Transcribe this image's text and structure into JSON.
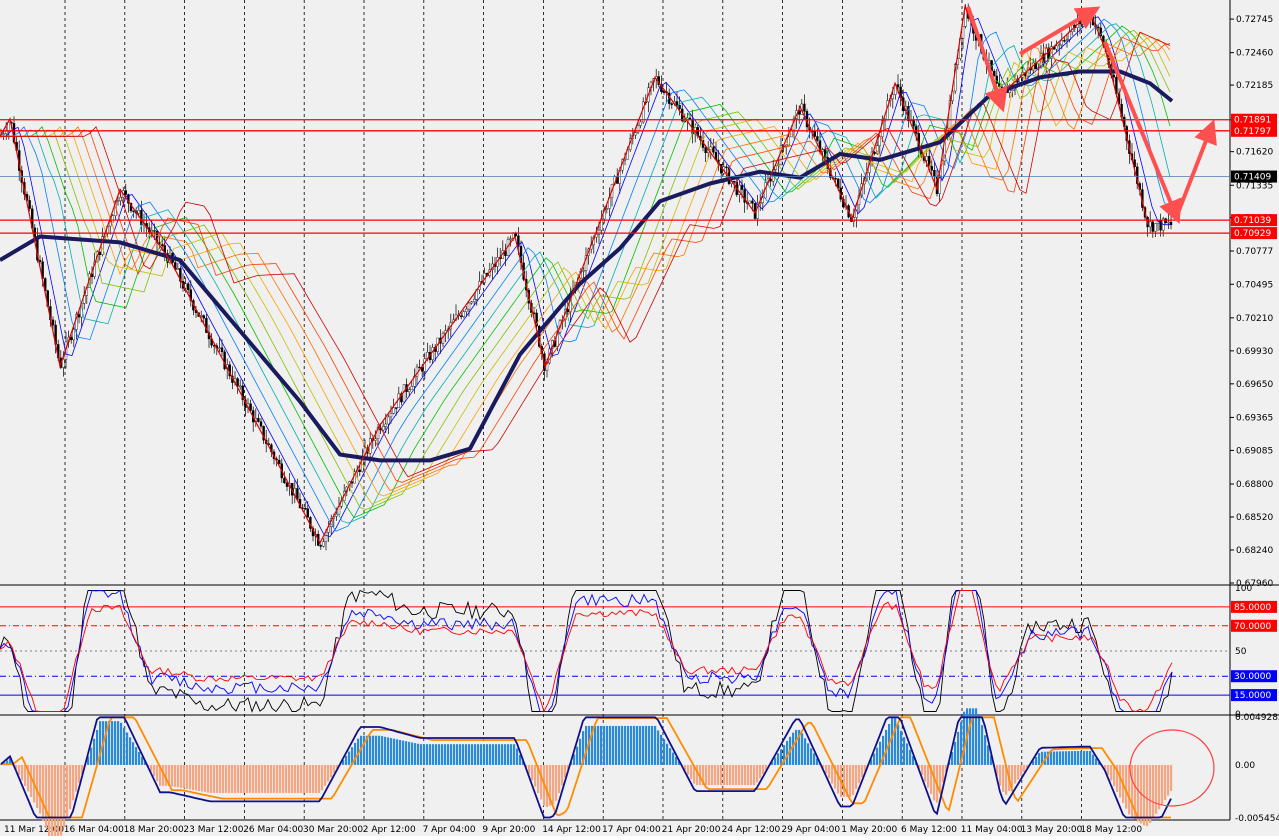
{
  "chart_data": [
    {
      "type": "candlestick",
      "panel": "price",
      "y_axis_ticks": [
        "0.72745",
        "0.72460",
        "0.72185",
        "0.71890",
        "0.71620",
        "0.71335",
        "0.71060",
        "0.70777",
        "0.70495",
        "0.70210",
        "0.69930",
        "0.69650",
        "0.69365",
        "0.69085",
        "0.68800",
        "0.68520",
        "0.68240",
        "0.67960"
      ],
      "ylim": [
        0.6796,
        0.7289
      ],
      "current_price": "0.71409",
      "levels": [
        {
          "label": "0.71891",
          "value": 0.71891,
          "color": "#ff0000"
        },
        {
          "label": "0.71797",
          "value": 0.71797,
          "color": "#ff0000"
        },
        {
          "label": "0.71039",
          "value": 0.71039,
          "color": "#ff0000"
        },
        {
          "label": "0.70929",
          "value": 0.70929,
          "color": "#ff0000"
        }
      ],
      "time_labels": [
        "11 Mar 12:00",
        "16 Mar 04:00",
        "18 Mar 20:00",
        "23 Mar 12:00",
        "26 Mar 04:00",
        "30 Mar 20:00",
        "2 Apr 12:00",
        "7 Apr 04:00",
        "9 Apr 20:00",
        "14 Apr 12:00",
        "17 Apr 04:00",
        "21 Apr 20:00",
        "24 Apr 12:00",
        "29 Apr 04:00",
        "1 May 20:00",
        "6 May 12:00",
        "11 May 04:00",
        "13 May 20:00",
        "18 May 12:00"
      ],
      "ma_slow": [
        [
          0,
          0.707
        ],
        [
          40,
          0.709
        ],
        [
          120,
          0.7085
        ],
        [
          180,
          0.707
        ],
        [
          240,
          0.701
        ],
        [
          300,
          0.695
        ],
        [
          340,
          0.6905
        ],
        [
          380,
          0.69
        ],
        [
          430,
          0.69
        ],
        [
          470,
          0.691
        ],
        [
          520,
          0.699
        ],
        [
          580,
          0.705
        ],
        [
          620,
          0.708
        ],
        [
          660,
          0.712
        ],
        [
          710,
          0.7135
        ],
        [
          760,
          0.7145
        ],
        [
          800,
          0.714
        ],
        [
          840,
          0.716
        ],
        [
          880,
          0.7155
        ],
        [
          940,
          0.717
        ],
        [
          990,
          0.721
        ],
        [
          1040,
          0.7225
        ],
        [
          1080,
          0.723
        ],
        [
          1120,
          0.723
        ],
        [
          1150,
          0.722
        ],
        [
          1172,
          0.7205
        ]
      ],
      "zigzag": [
        [
          0,
          0.7175
        ],
        [
          10,
          0.719
        ],
        [
          60,
          0.698
        ],
        [
          120,
          0.713
        ],
        [
          170,
          0.707
        ],
        [
          320,
          0.683
        ],
        [
          380,
          0.693
        ],
        [
          515,
          0.709
        ],
        [
          545,
          0.698
        ],
        [
          655,
          0.7225
        ],
        [
          755,
          0.711
        ],
        [
          800,
          0.72
        ],
        [
          852,
          0.7105
        ],
        [
          895,
          0.722
        ],
        [
          937,
          0.713
        ],
        [
          965,
          0.7285
        ],
        [
          1000,
          0.721
        ],
        [
          1040,
          0.724
        ],
        [
          1090,
          0.728
        ],
        [
          1105,
          0.725
        ],
        [
          1148,
          0.71
        ]
      ],
      "arrows": [
        [
          [
            968,
            0.7285
          ],
          [
            1000,
            0.7205
          ]
        ],
        [
          [
            1020,
            0.7245
          ],
          [
            1090,
            0.728
          ]
        ],
        [
          [
            1105,
            0.7255
          ],
          [
            1175,
            0.711
          ]
        ],
        [
          [
            1178,
            0.711
          ],
          [
            1210,
            0.718
          ]
        ]
      ]
    },
    {
      "type": "line",
      "panel": "oscillator",
      "ylim": [
        0,
        100
      ],
      "y_axis_ticks": [
        "100",
        "50",
        "0"
      ],
      "levels": [
        {
          "label": "85.0000",
          "value": 85,
          "color": "#ff0000"
        },
        {
          "label": "70.0000",
          "value": 70,
          "color": "#ff0000"
        },
        {
          "label": "30.0000",
          "value": 30,
          "color": "#0000ff"
        },
        {
          "label": "15.0000",
          "value": 15,
          "color": "#0000ff"
        }
      ]
    },
    {
      "type": "bar",
      "panel": "histogram",
      "ylim": [
        -0.005454,
        0.004928
      ],
      "y_axis_ticks": [
        "0.0049282",
        "0.00",
        "-0.005454"
      ]
    }
  ]
}
